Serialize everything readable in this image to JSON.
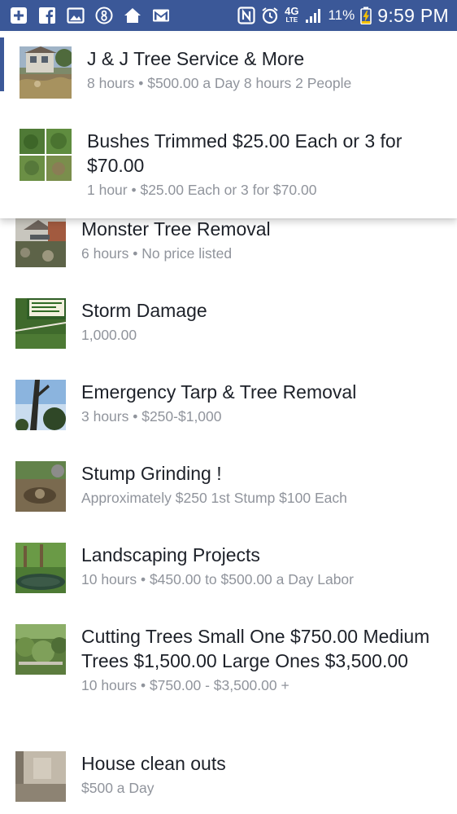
{
  "status_bar": {
    "left_icons": [
      "plus-square-icon",
      "facebook-icon",
      "image-icon",
      "vibrate-circle-icon",
      "home-icon",
      "gmail-icon"
    ],
    "right_icons": [
      "nfc-icon",
      "alarm-clock-icon",
      "lte-icon",
      "signal-bars-icon",
      "battery-charging-icon"
    ],
    "network": "4G",
    "network_sub": "LTE",
    "battery": "11%",
    "time": "9:59 PM"
  },
  "popup": {
    "items": [
      {
        "title": "J & J Tree Service & More",
        "subtitle": "8 hours • $500.00 a Day 8 hours 2 People"
      },
      {
        "title": "Bushes Trimmed $25.00 Each or 3 for $70.00",
        "subtitle": "1 hour • $25.00 Each or 3 for  $70.00"
      }
    ]
  },
  "services": [
    {
      "title": "Monster Tree Removal",
      "subtitle": "6 hours • No price listed"
    },
    {
      "title": "Storm Damage",
      "subtitle": "1,000.00"
    },
    {
      "title": "Emergency Tarp & Tree Removal",
      "subtitle": "3 hours • $250-$1,000"
    },
    {
      "title": "Stump Grinding !",
      "subtitle": "Approximately $250 1st Stump $100 Each"
    },
    {
      "title": "Landscaping Projects",
      "subtitle": "10 hours • $450.00 to $500.00 a Day Labor"
    },
    {
      "title": "Cutting Trees Small One $750.00 Medium Trees $1,500.00 Large Ones $3,500.00",
      "subtitle": "10 hours • $750.00 - $3,500.00 +"
    },
    {
      "title": "House clean outs",
      "subtitle": "$500 a Day"
    }
  ],
  "colors": {
    "status_bar": "#3b5898",
    "title_text": "#1d2129",
    "subtitle_text": "#90949c"
  }
}
